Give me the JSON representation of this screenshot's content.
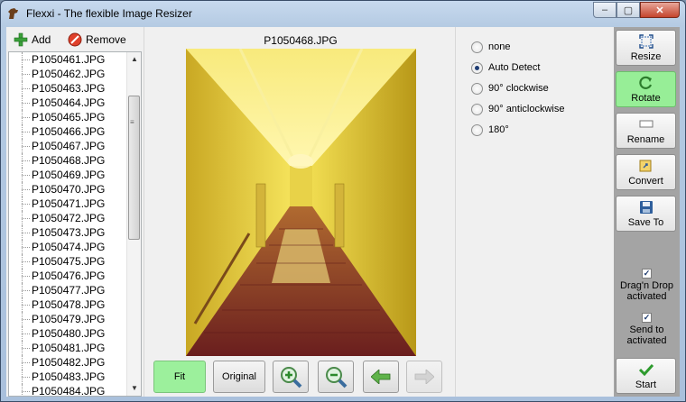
{
  "window": {
    "title": "Flexxi - The flexible Image Resizer",
    "controls": {
      "minimize": "–",
      "maximize": "▢",
      "close": "✕"
    }
  },
  "toolbar": {
    "add_label": "Add",
    "remove_label": "Remove"
  },
  "file_list": [
    "P1050461.JPG",
    "P1050462.JPG",
    "P1050463.JPG",
    "P1050464.JPG",
    "P1050465.JPG",
    "P1050466.JPG",
    "P1050467.JPG",
    "P1050468.JPG",
    "P1050469.JPG",
    "P1050470.JPG",
    "P1050471.JPG",
    "P1050472.JPG",
    "P1050473.JPG",
    "P1050474.JPG",
    "P1050475.JPG",
    "P1050476.JPG",
    "P1050477.JPG",
    "P1050478.JPG",
    "P1050479.JPG",
    "P1050480.JPG",
    "P1050481.JPG",
    "P1050482.JPG",
    "P1050483.JPG",
    "P1050484.JPG"
  ],
  "preview": {
    "image_title": "P1050468.JPG",
    "fit_label": "Fit",
    "original_label": "Original",
    "zoom_in_icon": "zoom-in-icon",
    "zoom_out_icon": "zoom-out-icon",
    "prev_icon": "arrow-left-icon",
    "next_icon": "arrow-right-icon"
  },
  "rotate_options": {
    "selected": "Auto Detect",
    "items": [
      "none",
      "Auto Detect",
      "90° clockwise",
      "90° anticlockwise",
      "180°"
    ]
  },
  "actions": {
    "resize": "Resize",
    "rotate": "Rotate",
    "rename": "Rename",
    "convert": "Convert",
    "save_to": "Save To",
    "start": "Start",
    "active": "Rotate"
  },
  "checkboxes": {
    "drag_drop": {
      "label_line1": "Drag'n Drop",
      "label_line2": "activated",
      "checked": true
    },
    "send_to": {
      "label_line1": "Send to",
      "label_line2": "activated",
      "checked": true
    }
  },
  "colors": {
    "active_green": "#97ee97",
    "fit_green": "#9cf09c",
    "action_panel_bg": "#a4a4a4"
  }
}
